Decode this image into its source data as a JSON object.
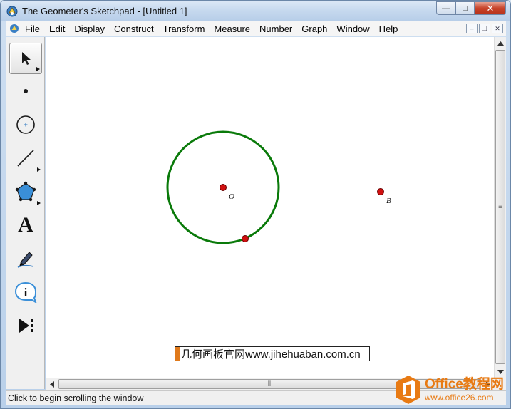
{
  "window": {
    "title": "The Geometer's Sketchpad - [Untitled 1]",
    "controls": {
      "minimize": "—",
      "maximize": "□",
      "close": "✕"
    }
  },
  "menubar": {
    "items": [
      {
        "label_accel": "F",
        "label_rest": "ile"
      },
      {
        "label_accel": "E",
        "label_rest": "dit"
      },
      {
        "label_accel": "D",
        "label_rest": "isplay"
      },
      {
        "label_accel": "C",
        "label_rest": "onstruct"
      },
      {
        "label_accel": "T",
        "label_rest": "ransform"
      },
      {
        "label_accel": "M",
        "label_rest": "easure"
      },
      {
        "label_accel": "N",
        "label_rest": "umber"
      },
      {
        "label_accel": "G",
        "label_rest": "raph"
      },
      {
        "label_accel": "W",
        "label_rest": "indow"
      },
      {
        "label_accel": "H",
        "label_rest": "elp"
      }
    ],
    "mdi_controls": {
      "minimize": "–",
      "restore": "❐",
      "close": "✕"
    }
  },
  "toolbox": {
    "tools": [
      {
        "name": "selection-arrow",
        "icon": "arrow-cursor-icon",
        "selected": true
      },
      {
        "name": "point",
        "icon": "point-icon"
      },
      {
        "name": "compass",
        "icon": "circle-compass-icon"
      },
      {
        "name": "straightedge",
        "icon": "line-segment-icon"
      },
      {
        "name": "polygon",
        "icon": "pentagon-icon"
      },
      {
        "name": "text",
        "icon": "text-a-icon",
        "glyph": "A"
      },
      {
        "name": "marker",
        "icon": "marker-pen-icon"
      },
      {
        "name": "information",
        "icon": "info-bubble-icon",
        "glyph": "i"
      },
      {
        "name": "custom",
        "icon": "custom-tool-icon"
      }
    ]
  },
  "sketch": {
    "circle_color": "#0a7a0a",
    "point_color": "#d01010",
    "points": [
      {
        "label": "O"
      },
      {
        "label": "B"
      },
      {
        "label": ""
      }
    ],
    "caption": "几何画板官网www.jihehuaban.com.cn"
  },
  "scrollbars": {
    "vertical_grip": "≡",
    "horizontal_grip": "⦀"
  },
  "statusbar": {
    "text": "Click to begin scrolling the window"
  },
  "watermark": {
    "title": "Office教程网",
    "url": "www.office26.com",
    "brand_color": "#e87a13"
  }
}
